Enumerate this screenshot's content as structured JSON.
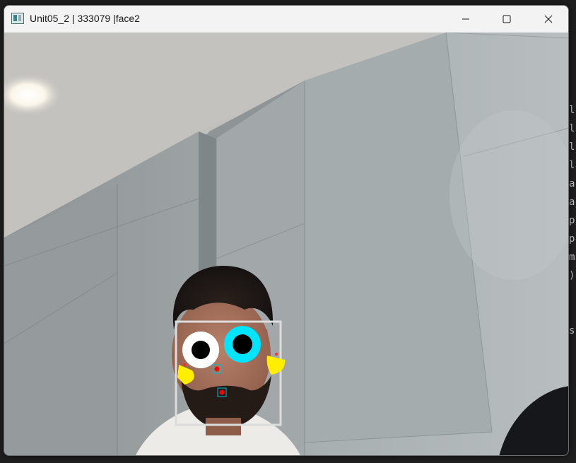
{
  "window": {
    "title": "Unit05_2 | 333079 |face2",
    "minimize_icon": "minimize-icon",
    "maximize_icon": "maximize-icon",
    "close_icon": "close-icon"
  },
  "background_editor": {
    "code_fragments": [
      "l",
      "l",
      "l",
      "l",
      "a",
      "a",
      "p",
      "p",
      "m",
      ")",
      "s"
    ]
  },
  "overlay": {
    "face_box_color": "#dcdcdc",
    "left_eye_color": "#ffffff",
    "right_eye_color": "#00e5ff",
    "pupil_color": "#000000",
    "ear_color": "#ffee00",
    "marker_color": "#ff0000",
    "marker_box_color": "#00bcd4"
  }
}
